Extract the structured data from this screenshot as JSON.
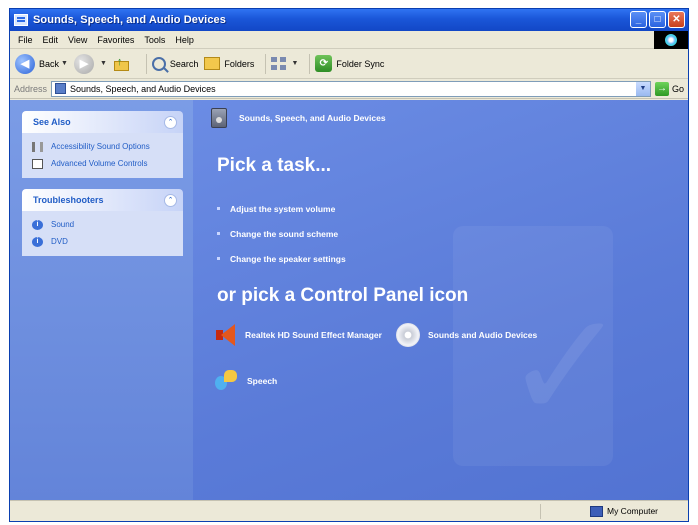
{
  "window": {
    "title": "Sounds, Speech, and Audio Devices",
    "controls": {
      "minimize": "_",
      "maximize": "□",
      "close": "✕"
    }
  },
  "menubar": {
    "items": [
      {
        "label": "File"
      },
      {
        "label": "Edit"
      },
      {
        "label": "View"
      },
      {
        "label": "Favorites"
      },
      {
        "label": "Tools"
      },
      {
        "label": "Help"
      }
    ]
  },
  "toolbar": {
    "back": "Back",
    "search": "Search",
    "folders": "Folders",
    "folder_sync": "Folder Sync"
  },
  "addressbar": {
    "label": "Address",
    "value": "Sounds, Speech, and Audio Devices",
    "go": "Go"
  },
  "taskpane": {
    "see_also": {
      "title": "See Also",
      "items": [
        {
          "label": "Accessibility Sound Options",
          "icon": "speaker-icon"
        },
        {
          "label": "Advanced Volume Controls",
          "icon": "document-icon"
        }
      ]
    },
    "troubleshooters": {
      "title": "Troubleshooters",
      "items": [
        {
          "label": "Sound",
          "icon": "info-icon"
        },
        {
          "label": "DVD",
          "icon": "info-icon"
        }
      ]
    }
  },
  "main": {
    "category_title": "Sounds, Speech, and Audio Devices",
    "pick_task": "Pick a task...",
    "tasks": [
      {
        "label": "Adjust the system volume"
      },
      {
        "label": "Change the sound scheme"
      },
      {
        "label": "Change the speaker settings"
      }
    ],
    "pick_icon": "or pick a Control Panel icon",
    "icons": [
      {
        "label": "Realtek HD Sound Effect Manager"
      },
      {
        "label": "Sounds and Audio Devices"
      },
      {
        "label": "Speech"
      }
    ]
  },
  "statusbar": {
    "location": "My Computer"
  },
  "colors": {
    "titlebar": "#1a56d8",
    "taskpane": "#6f90df",
    "main_bg": "#5a7bd8",
    "link": "#215dc6"
  }
}
